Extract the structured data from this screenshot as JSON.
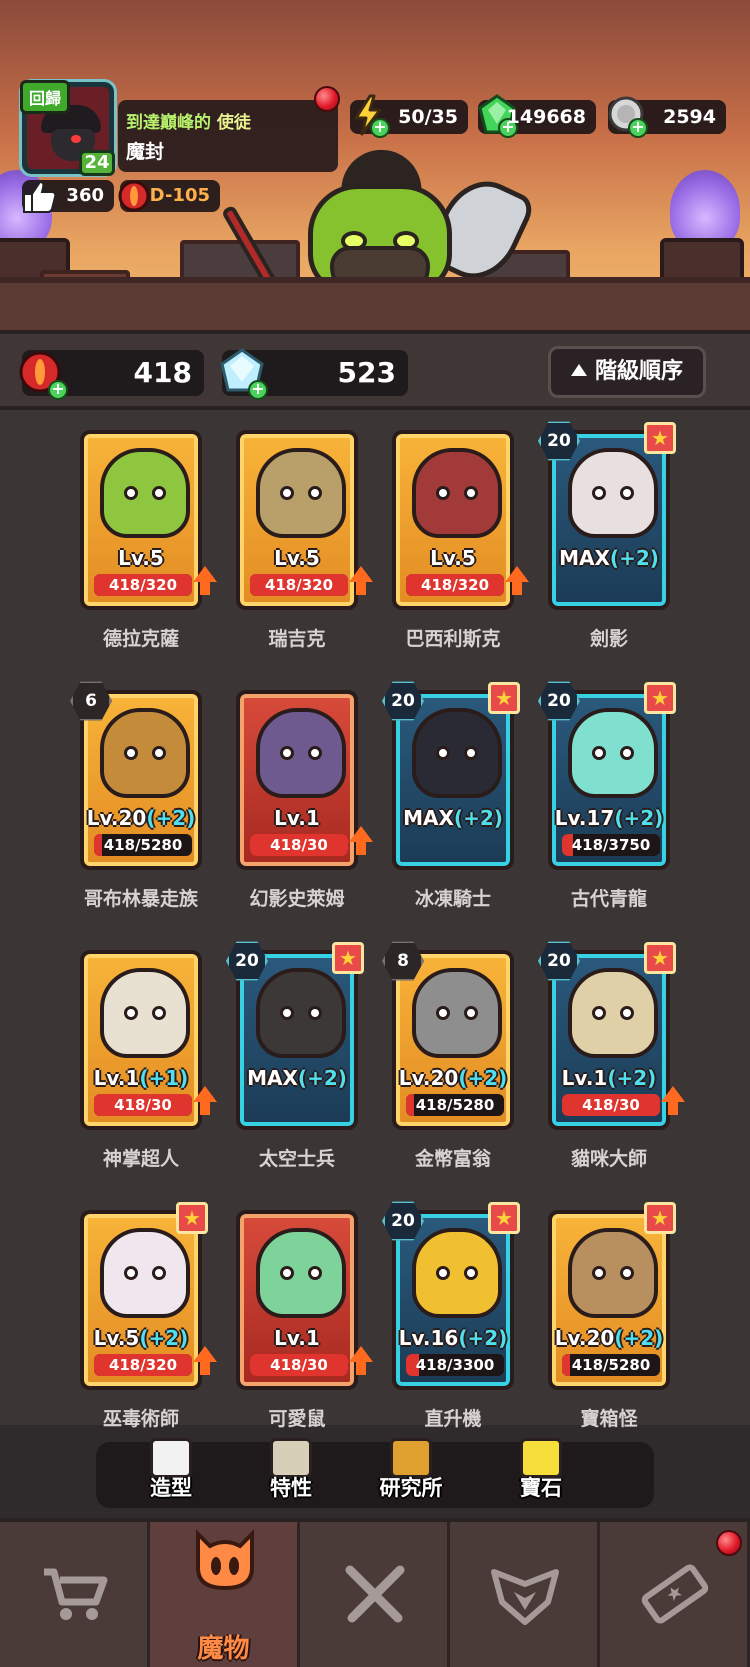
{
  "player": {
    "back_label": "回歸",
    "level": "24",
    "title_part1": "到達巔峰的",
    "title_part2": "使徒",
    "name": "魔封",
    "likes": "360",
    "dungeon": "D-105"
  },
  "resources": {
    "energy": "50/35",
    "gems": "149668",
    "coins": "2594"
  },
  "currencies": {
    "red_orb": "418",
    "crystal": "523"
  },
  "sort_button": "階級順序",
  "monsters": [
    {
      "name": "德拉克薩",
      "frame": "gold",
      "level_text": "Lv.5",
      "bonus": "",
      "progress": "418/320",
      "progress_fraction": 1.0,
      "upgrade": true,
      "hex": "",
      "star": false
    },
    {
      "name": "瑞吉克",
      "frame": "gold",
      "level_text": "Lv.5",
      "bonus": "",
      "progress": "418/320",
      "progress_fraction": 1.0,
      "upgrade": true,
      "hex": "",
      "star": false
    },
    {
      "name": "巴西利斯克",
      "frame": "gold",
      "level_text": "Lv.5",
      "bonus": "",
      "progress": "418/320",
      "progress_fraction": 1.0,
      "upgrade": true,
      "hex": "",
      "star": false
    },
    {
      "name": "劍影",
      "frame": "blue",
      "level_text": "MAX",
      "bonus": "(+2)",
      "progress": "",
      "progress_fraction": 0,
      "upgrade": false,
      "hex": "20",
      "star": true
    },
    {
      "name": "哥布林暴走族",
      "frame": "gold",
      "level_text": "Lv.20",
      "bonus": "(+2)",
      "progress": "418/5280",
      "progress_fraction": 0.08,
      "upgrade": false,
      "hex": "6",
      "star": false
    },
    {
      "name": "幻影史萊姆",
      "frame": "red",
      "level_text": "Lv.1",
      "bonus": "",
      "progress": "418/30",
      "progress_fraction": 1.0,
      "upgrade": true,
      "hex": "",
      "star": false
    },
    {
      "name": "冰凍騎士",
      "frame": "blue",
      "level_text": "MAX",
      "bonus": "(+2)",
      "progress": "",
      "progress_fraction": 0,
      "upgrade": false,
      "hex": "20",
      "star": true
    },
    {
      "name": "古代青龍",
      "frame": "blue",
      "level_text": "Lv.17",
      "bonus": "(+2)",
      "progress": "418/3750",
      "progress_fraction": 0.11,
      "upgrade": false,
      "hex": "20",
      "star": true
    },
    {
      "name": "神掌超人",
      "frame": "gold",
      "level_text": "Lv.1",
      "bonus": "(+1)",
      "progress": "418/30",
      "progress_fraction": 1.0,
      "upgrade": true,
      "hex": "",
      "star": false
    },
    {
      "name": "太空士兵",
      "frame": "blue",
      "level_text": "MAX",
      "bonus": "(+2)",
      "progress": "",
      "progress_fraction": 0,
      "upgrade": false,
      "hex": "20",
      "star": true
    },
    {
      "name": "金幣富翁",
      "frame": "gold",
      "level_text": "Lv.20",
      "bonus": "(+2)",
      "progress": "418/5280",
      "progress_fraction": 0.08,
      "upgrade": false,
      "hex": "8",
      "star": false
    },
    {
      "name": "貓咪大師",
      "frame": "blue",
      "level_text": "Lv.1",
      "bonus": "(+2)",
      "progress": "418/30",
      "progress_fraction": 1.0,
      "upgrade": true,
      "hex": "20",
      "star": true
    },
    {
      "name": "巫毒術師",
      "frame": "gold",
      "level_text": "Lv.5",
      "bonus": "(+2)",
      "progress": "418/320",
      "progress_fraction": 1.0,
      "upgrade": true,
      "hex": "",
      "star": true
    },
    {
      "name": "可愛鼠",
      "frame": "red",
      "level_text": "Lv.1",
      "bonus": "",
      "progress": "418/30",
      "progress_fraction": 1.0,
      "upgrade": true,
      "hex": "",
      "star": false
    },
    {
      "name": "直升機",
      "frame": "blue",
      "level_text": "Lv.16",
      "bonus": "(+2)",
      "progress": "418/3300",
      "progress_fraction": 0.13,
      "upgrade": false,
      "hex": "20",
      "star": true
    },
    {
      "name": "寶箱怪",
      "frame": "gold",
      "level_text": "Lv.20",
      "bonus": "(+2)",
      "progress": "418/5280",
      "progress_fraction": 0.08,
      "upgrade": false,
      "hex": "",
      "star": true
    }
  ],
  "subnav": [
    {
      "label": "造型",
      "icon": "shirt-icon",
      "color": "#f2f2f2"
    },
    {
      "label": "特性",
      "icon": "scroll-icon",
      "color": "#d8cfb8"
    },
    {
      "label": "研究所",
      "icon": "gear-icon",
      "color": "#e0a030"
    },
    {
      "label": "寶石",
      "icon": "gem-icon",
      "color": "#f5dd3a"
    }
  ],
  "bottom_nav": [
    {
      "label": "",
      "icon": "cart-icon"
    },
    {
      "label": "魔物",
      "icon": "monster-icon"
    },
    {
      "label": "",
      "icon": "swords-icon"
    },
    {
      "label": "",
      "icon": "rank-emblem-icon"
    },
    {
      "label": "",
      "icon": "ticket-icon"
    }
  ],
  "colors": {
    "gold_frame": "#f8b439",
    "red_frame": "#d84b3b",
    "blue_frame": "#2a5a7d",
    "bonus": "#4fe0f0",
    "upgrade_arrow": "#ff6a1e",
    "active_tab_label": "#ff8a46"
  }
}
